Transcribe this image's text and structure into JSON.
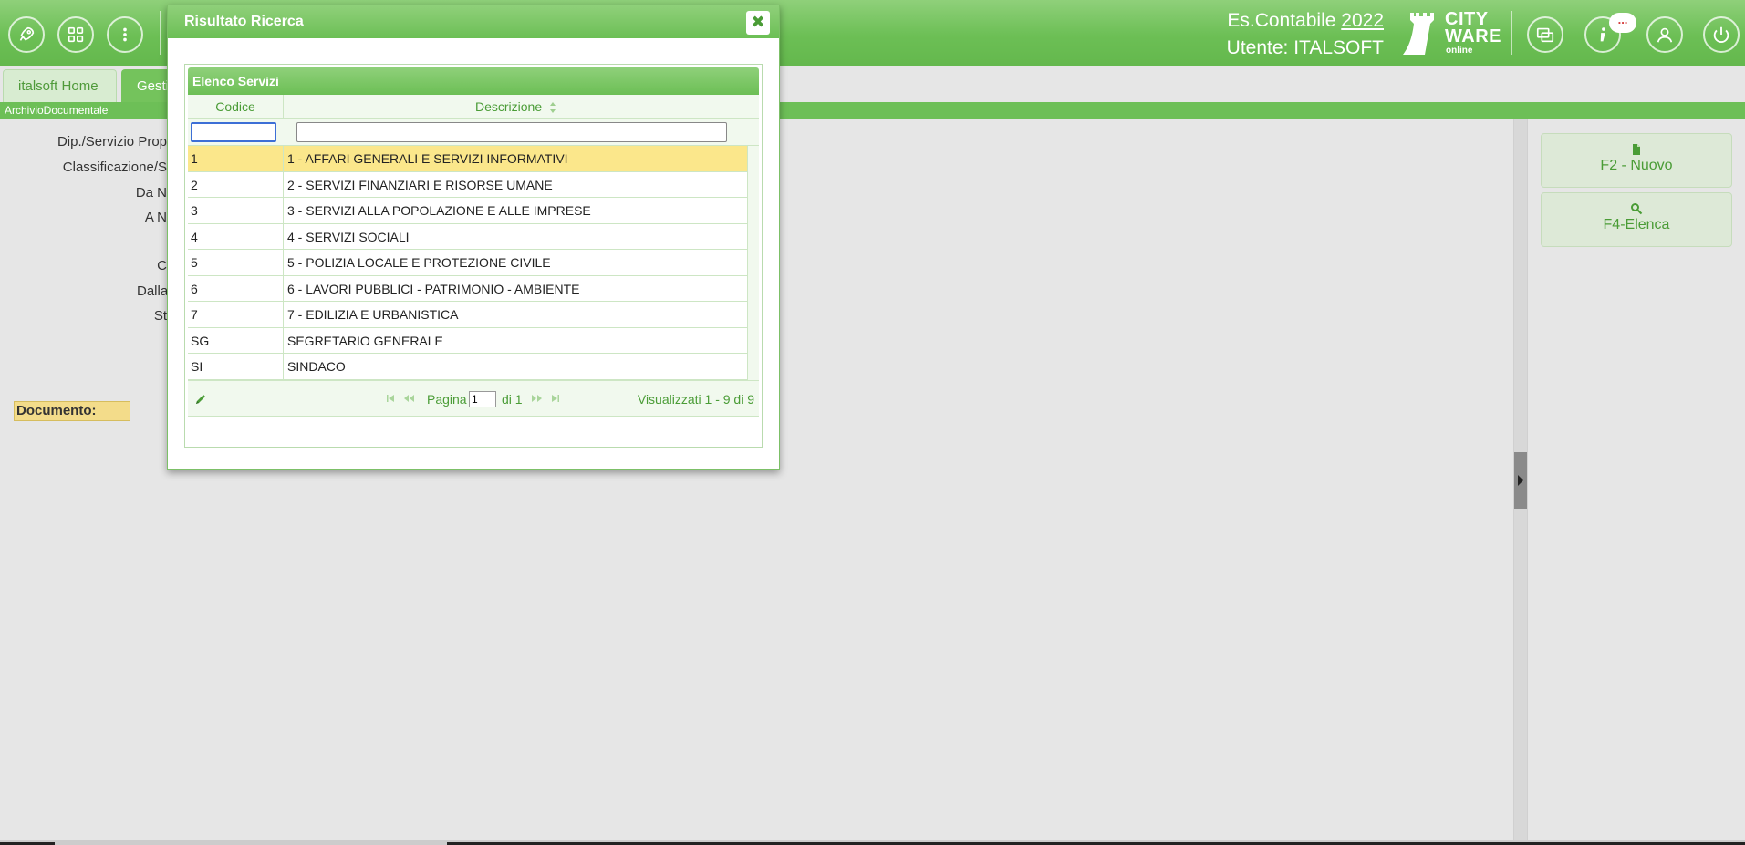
{
  "header": {
    "es_label": "Es.Contabile",
    "es_year": "2022",
    "user_label": "Utente: ITALSOFT",
    "logo_line1": "CITY",
    "logo_line2": "WARE",
    "logo_sub": "online",
    "notif_badge": "...",
    "icons": [
      "rocket-icon",
      "apps-grid-icon",
      "more-vertical-icon",
      "windows-icon",
      "info-icon",
      "user-icon",
      "power-icon"
    ]
  },
  "tabs": [
    {
      "label": "italsoft Home"
    },
    {
      "label": "Gesti"
    }
  ],
  "breadcrumb": "ArchivioDocumentale",
  "form": {
    "labels": [
      "Dip./Servizio Prop",
      "Classificazione/S",
      "Da N",
      "A N",
      "C",
      "Dalla",
      "St"
    ],
    "documento_label": "Documento:"
  },
  "actions": {
    "new_label": "F2 - Nuovo",
    "list_label": "F4-Elenca"
  },
  "modal": {
    "title": "Risultato Ricerca",
    "close_glyph": "✖",
    "grid": {
      "caption": "Elenco Servizi",
      "columns": [
        "Codice",
        "Descrizione"
      ],
      "filter_code_value": "",
      "filter_desc_value": "",
      "rows": [
        {
          "code": "1",
          "desc": "1 - AFFARI GENERALI E SERVIZI INFORMATIVI"
        },
        {
          "code": "2",
          "desc": "2 - SERVIZI FINANZIARI E RISORSE UMANE"
        },
        {
          "code": "3",
          "desc": "3 - SERVIZI ALLA POPOLAZIONE E ALLE IMPRESE"
        },
        {
          "code": "4",
          "desc": "4 - SERVIZI SOCIALI"
        },
        {
          "code": "5",
          "desc": "5 - POLIZIA LOCALE E PROTEZIONE CIVILE"
        },
        {
          "code": "6",
          "desc": "6 - LAVORI PUBBLICI - PATRIMONIO - AMBIENTE"
        },
        {
          "code": "7",
          "desc": "7 - EDILIZIA E URBANISTICA"
        },
        {
          "code": "SG",
          "desc": "SEGRETARIO GENERALE"
        },
        {
          "code": "SI",
          "desc": "SINDACO"
        }
      ],
      "selected_index": 0
    },
    "pager": {
      "page_label": "Pagina",
      "page_value": "1",
      "of_label": "di 1",
      "info": "Visualizzati 1 - 9 di 9"
    }
  },
  "colors": {
    "brand_green": "#6cbf55",
    "accent_text": "#4a9c36",
    "selected_row": "#fbe78b",
    "document_label": "#f3dc8a"
  }
}
